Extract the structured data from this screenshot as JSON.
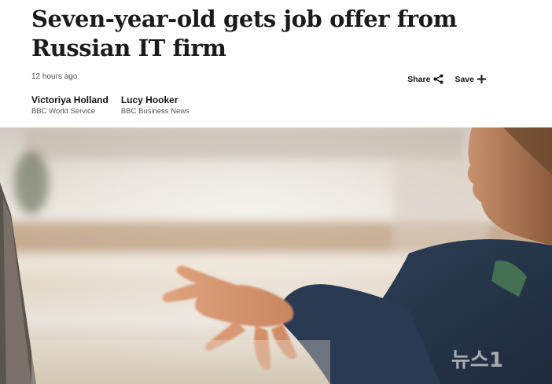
{
  "article": {
    "headline": "Seven-year-old gets job offer from Russian IT firm",
    "timestamp": "12 hours ago"
  },
  "actions": {
    "share_label": "Share",
    "share_icon": "share-icon",
    "save_label": "Save",
    "save_icon": "plus-icon"
  },
  "authors": [
    {
      "name": "Victoriya Holland",
      "org": "BBC World Service"
    },
    {
      "name": "Lucy Hooker",
      "org": "BBC Business News"
    }
  ],
  "hero_image": {
    "subject": "child-hand-near-laptop-photo",
    "watermark_text": "뉴스1"
  }
}
